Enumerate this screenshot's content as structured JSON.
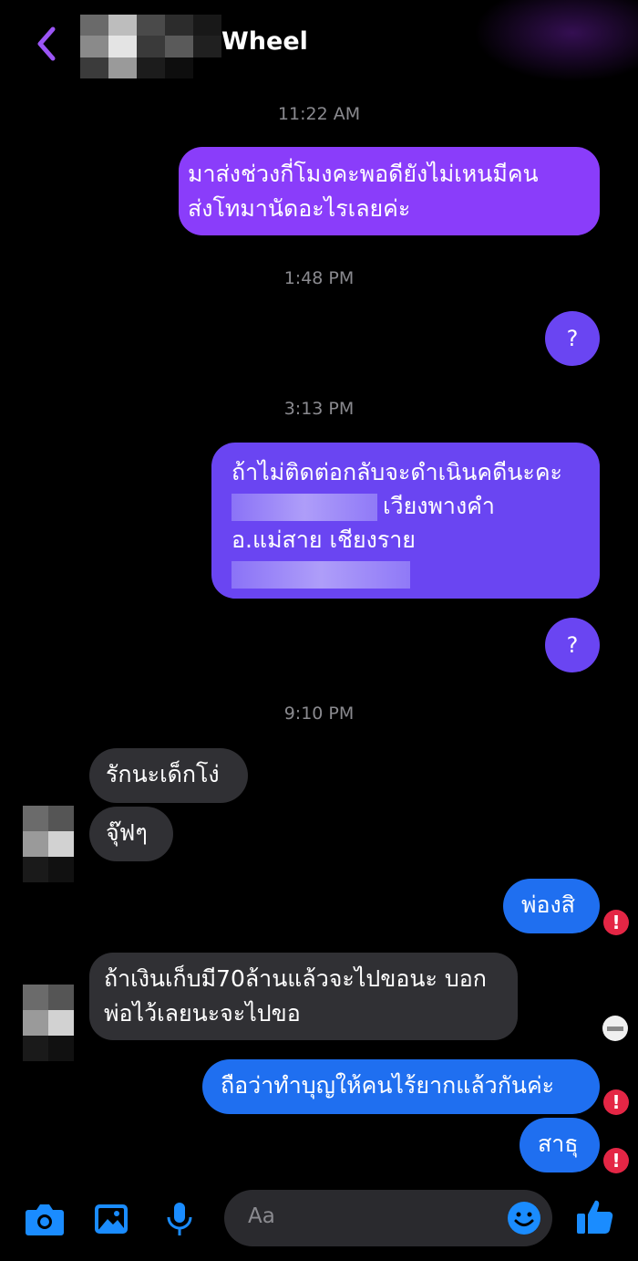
{
  "header": {
    "contact_name_visible": "Wheel",
    "back_icon": "chevron-left-icon"
  },
  "timestamps": [
    "11:22 AM",
    "1:48 PM",
    "3:13 PM",
    "9:10 PM"
  ],
  "messages": {
    "m1_line1": "มาส่งช่วงกี่โมงคะพอดียังไม่เหนมีคน",
    "m1_line2": "ส่งโทมานัดอะไรเลยค่ะ",
    "m2": "?",
    "m3_line1": "ถ้าไม่ติดต่อกลับจะดำเนินคดีนะคะ",
    "m3_line2": "เวียงพางคำ",
    "m3_line3": "อ.แม่สาย เชียงราย",
    "m4": "?",
    "m5": "รักนะเด็กโง่",
    "m6": "จุ๊ฟๆ",
    "m7": "พ่องสิ",
    "m8_line1": "ถ้าเงินเก็บมี70ล้านแล้วจะไปขอนะ บอก",
    "m8_line2": "พ่อไว้เลยนะจะไปขอ",
    "m9": "ถือว่าทำบุญให้คนไร้ยากแล้วกันค่ะ",
    "m10": "สาธุ"
  },
  "status": {
    "error_mark": "!"
  },
  "composer": {
    "placeholder": "Aa",
    "icons": [
      "camera-icon",
      "image-icon",
      "microphone-icon",
      "emoji-icon",
      "thumbs-up-icon"
    ]
  },
  "colors": {
    "background": "#000000",
    "bubble_purple": "#8a3dfa",
    "bubble_violet": "#6a45f2",
    "bubble_blue": "#1f6ff0",
    "bubble_incoming": "#303034",
    "accent_icon": "#1a8cff",
    "back_chevron": "#9b55f5",
    "error": "#e42645"
  }
}
